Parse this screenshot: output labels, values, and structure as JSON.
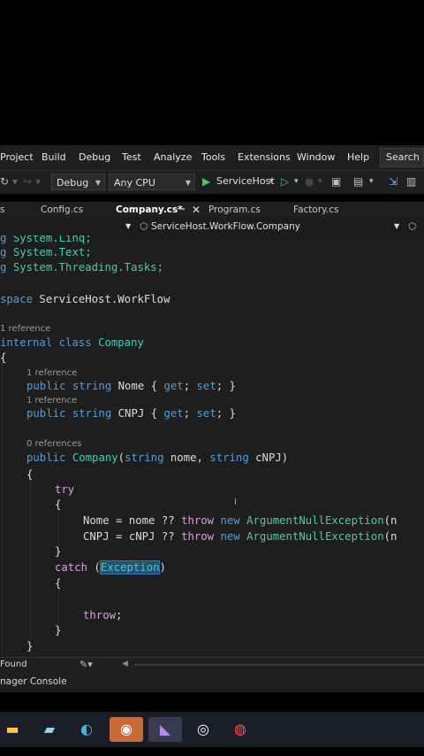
{
  "menu": [
    "Project",
    "Build",
    "Debug",
    "Test",
    "Analyze",
    "Tools",
    "Extensions",
    "Window",
    "Help"
  ],
  "search_label": "Search (C",
  "toolbar": {
    "config": "Debug",
    "platform": "Any CPU",
    "startup": "ServiceHost"
  },
  "tabs": [
    {
      "label": "s"
    },
    {
      "label": "Config.cs"
    },
    {
      "label": "Company.cs*"
    },
    {
      "label": "Program.cs"
    },
    {
      "label": "Factory.cs"
    }
  ],
  "nav": {
    "member": "ServiceHost.WorkFlow.Company"
  },
  "code": {
    "u1_a": "g ",
    "u1_b": "System.Linq;",
    "u2_a": "g ",
    "u2_b": "System.Text;",
    "u3_a": "g ",
    "u3_b": "System.Threading.Tasks;",
    "ns_kw": "space ",
    "ns_name": "ServiceHost.WorkFlow",
    "ref_class": "1 reference",
    "cls_kw": "internal class ",
    "cls_name": "Company",
    "open1": "{",
    "ref_nome": "1 reference",
    "nome_kw": "public string ",
    "nome_name": "Nome ",
    "nome_rest_a": "{ ",
    "nome_get": "get",
    "nome_semi1": "; ",
    "nome_set": "set",
    "nome_rest_b": "; }",
    "ref_cnpj": "1 reference",
    "cnpj_kw": "public string ",
    "cnpj_name": "CNPJ ",
    "cnpj_rest_a": "{ ",
    "cnpj_get": "get",
    "cnpj_semi1": "; ",
    "cnpj_set": "set",
    "cnpj_rest_b": "; }",
    "ref_ctor": "0 references",
    "ctor_kw": "public ",
    "ctor_name": "Company",
    "ctor_p1": "(",
    "ctor_str1": "string",
    "ctor_a1": " nome, ",
    "ctor_str2": "string",
    "ctor_a2": " cNPJ)",
    "open2": "{",
    "try_kw": "try",
    "open3": "{",
    "l1_a": "Nome = nome ?? ",
    "l1_throw": "throw",
    "l1_sp": " ",
    "l1_new": "new",
    "l1_sp2": " ",
    "l1_ty": "ArgumentNullException",
    "l1_end": "(n",
    "l2_a": "CNPJ = cNPJ ?? ",
    "l2_throw": "throw",
    "l2_sp": " ",
    "l2_new": "new",
    "l2_sp2": " ",
    "l2_ty": "ArgumentNullException",
    "l2_end": "(n",
    "close3": "}",
    "catch_kw": "catch",
    "catch_p": " (",
    "catch_ty": "Exception",
    "catch_end": ")",
    "open4": "{",
    "throw_kw": "throw",
    "throw_end": ";",
    "close4": "}",
    "close2": "}"
  },
  "status": {
    "left": "Found",
    "console": "nager Console"
  },
  "colors": {
    "keyword": "#569cd6",
    "control": "#d8a0df",
    "type": "#4ec9b0",
    "accent": "#9b7bd8"
  }
}
